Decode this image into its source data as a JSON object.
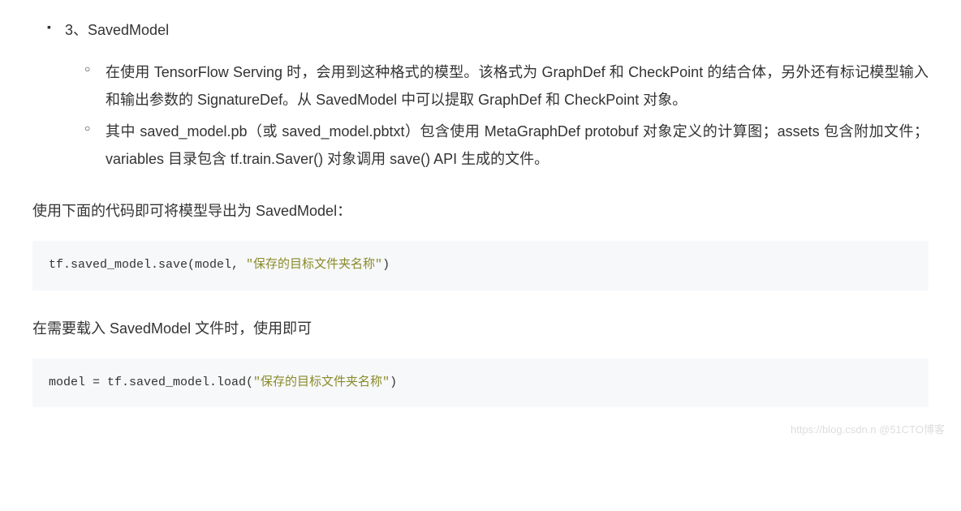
{
  "list": {
    "outer_title": "3、SavedModel",
    "inner_items": [
      "在使用 TensorFlow Serving 时，会用到这种格式的模型。该格式为 GraphDef 和 CheckPoint 的结合体，另外还有标记模型输入和输出参数的 SignatureDef。从 SavedModel 中可以提取 GraphDef 和 CheckPoint 对象。",
      "其中 saved_model.pb（或 saved_model.pbtxt）包含使用 MetaGraphDef protobuf 对象定义的计算图；assets 包含附加文件；variables 目录包含 tf.train.Saver() 对象调用 save() API 生成的文件。"
    ]
  },
  "para1": "使用下面的代码即可将模型导出为 SavedModel：",
  "code1": {
    "prefix": "tf.saved_model.save(model, ",
    "string": "\"保存的目标文件夹名称\"",
    "suffix": ")"
  },
  "para2": "在需要载入 SavedModel 文件时，使用即可",
  "code2": {
    "prefix": "model = tf.saved_model.load(",
    "string": "\"保存的目标文件夹名称\"",
    "suffix": ")"
  },
  "watermark": "https://blog.csdn.n @51CTO博客"
}
